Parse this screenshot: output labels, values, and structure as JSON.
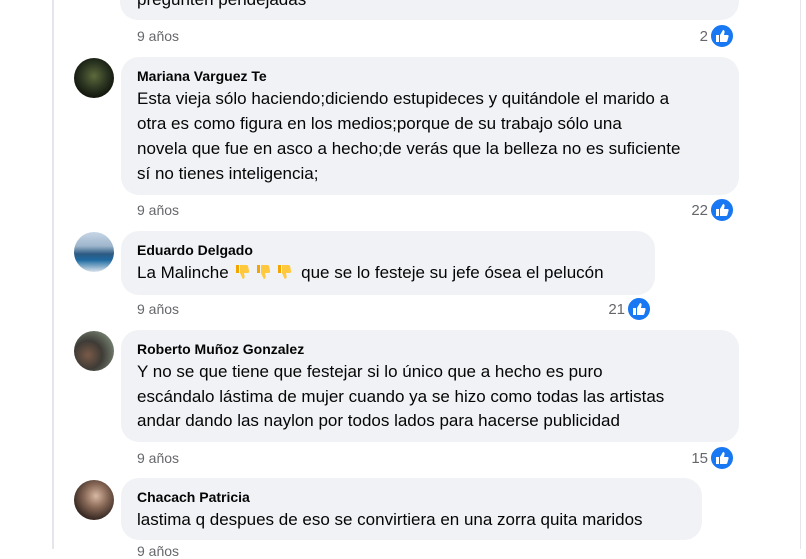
{
  "comments": [
    {
      "author": "",
      "lines": [
        "pregunten pendejadas"
      ],
      "time": "9 años",
      "likes": "2"
    },
    {
      "author": "Mariana Varguez Te",
      "lines": [
        "Esta vieja sólo haciendo;diciendo estupideces y quitándole el marido a",
        "otra es como figura en los medios;porque de su trabajo sólo una",
        "novela que fue en asco a hecho;de verás que la belleza no es suficiente",
        "sí no tienes inteligencia;"
      ],
      "time": "9 años",
      "likes": "22"
    },
    {
      "author": "Eduardo Delgado",
      "text_before": "La Malinche",
      "emoji": "thumbs-down-emoji",
      "text_after": "que se lo festeje su jefe ósea el pelucón",
      "time": "9 años",
      "likes": "21"
    },
    {
      "author": "Roberto Muñoz Gonzalez",
      "lines": [
        "Y no se que tiene que festejar si lo único que a hecho es puro",
        "escándalo lástima de mujer cuando ya se hizo como todas las artistas",
        "andar dando las naylon por todos lados para hacerse publicidad"
      ],
      "time": "9 años",
      "likes": "15"
    },
    {
      "author": "Chacach Patricia",
      "lines": [
        "lastima q despues de eso se convirtiera en una zorra quita maridos"
      ],
      "time": "9 años"
    }
  ],
  "colors": {
    "bubble": "#f0f2f5",
    "like": "#1877f2",
    "meta": "#65676b",
    "text": "#050505"
  }
}
